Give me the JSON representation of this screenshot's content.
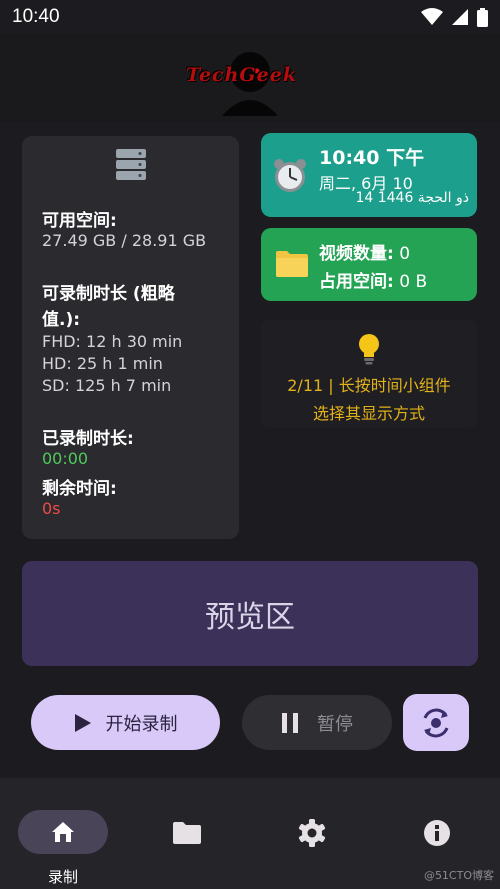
{
  "status_bar": {
    "time": "10:40"
  },
  "header": {
    "logo_text": "TechGeek"
  },
  "storage": {
    "available_label": "可用空间:",
    "available_value": "27.49 GB / 28.91 GB",
    "duration_label_line1": "可录制时长 (粗略",
    "duration_label_line2": "值.):",
    "fhd": "FHD: 12 h 30 min",
    "hd": "HD: 25 h 1 min",
    "sd": "SD: 125 h 7 min",
    "recorded_label": "已录制时长:",
    "recorded_value": "00:00",
    "remaining_label": "剩余时间:",
    "remaining_value": "0s"
  },
  "clock_widget": {
    "time": "10:40 下午",
    "date": "周二, 6月 10",
    "hijri_date": "14 ذو الحجة 1446"
  },
  "files_widget": {
    "video_count_label": "视频数量:",
    "video_count_value": "0",
    "used_space_label": "占用空间:",
    "used_space_value": "0 B"
  },
  "tip": {
    "line1": "2/11 | 长按时间小组件",
    "line2": "选择其显示方式"
  },
  "preview": {
    "label": "预览区"
  },
  "controls": {
    "start_label": "开始录制",
    "pause_label": "暂停"
  },
  "nav": {
    "items": [
      {
        "icon": "home-icon",
        "label": "录制"
      },
      {
        "icon": "folder-icon",
        "label": ""
      },
      {
        "icon": "gear-icon",
        "label": ""
      },
      {
        "icon": "info-icon",
        "label": ""
      }
    ]
  },
  "watermark": "@51CTO博客",
  "colors": {
    "background": "#1c1b1f",
    "card": "#2b2a2e",
    "clock_card": "#1c9f8c",
    "files_card": "#25a354",
    "tip_text": "#e2b21a",
    "preview": "#3c3259",
    "accent_button": "#d9c9f8",
    "recorded_green": "#4fc95d",
    "remaining_red": "#ef4b4b"
  }
}
